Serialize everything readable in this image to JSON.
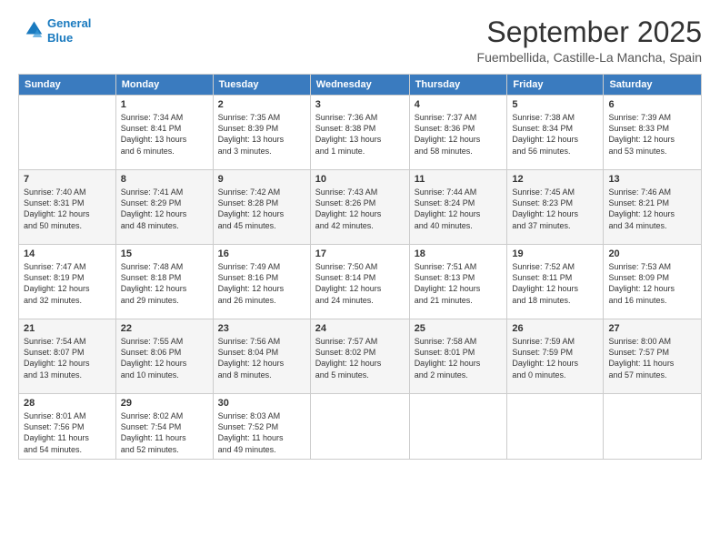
{
  "header": {
    "logo_line1": "General",
    "logo_line2": "Blue",
    "month_title": "September 2025",
    "location": "Fuembellida, Castille-La Mancha, Spain"
  },
  "days_of_week": [
    "Sunday",
    "Monday",
    "Tuesday",
    "Wednesday",
    "Thursday",
    "Friday",
    "Saturday"
  ],
  "weeks": [
    [
      {
        "day": "",
        "info": ""
      },
      {
        "day": "1",
        "info": "Sunrise: 7:34 AM\nSunset: 8:41 PM\nDaylight: 13 hours\nand 6 minutes."
      },
      {
        "day": "2",
        "info": "Sunrise: 7:35 AM\nSunset: 8:39 PM\nDaylight: 13 hours\nand 3 minutes."
      },
      {
        "day": "3",
        "info": "Sunrise: 7:36 AM\nSunset: 8:38 PM\nDaylight: 13 hours\nand 1 minute."
      },
      {
        "day": "4",
        "info": "Sunrise: 7:37 AM\nSunset: 8:36 PM\nDaylight: 12 hours\nand 58 minutes."
      },
      {
        "day": "5",
        "info": "Sunrise: 7:38 AM\nSunset: 8:34 PM\nDaylight: 12 hours\nand 56 minutes."
      },
      {
        "day": "6",
        "info": "Sunrise: 7:39 AM\nSunset: 8:33 PM\nDaylight: 12 hours\nand 53 minutes."
      }
    ],
    [
      {
        "day": "7",
        "info": "Sunrise: 7:40 AM\nSunset: 8:31 PM\nDaylight: 12 hours\nand 50 minutes."
      },
      {
        "day": "8",
        "info": "Sunrise: 7:41 AM\nSunset: 8:29 PM\nDaylight: 12 hours\nand 48 minutes."
      },
      {
        "day": "9",
        "info": "Sunrise: 7:42 AM\nSunset: 8:28 PM\nDaylight: 12 hours\nand 45 minutes."
      },
      {
        "day": "10",
        "info": "Sunrise: 7:43 AM\nSunset: 8:26 PM\nDaylight: 12 hours\nand 42 minutes."
      },
      {
        "day": "11",
        "info": "Sunrise: 7:44 AM\nSunset: 8:24 PM\nDaylight: 12 hours\nand 40 minutes."
      },
      {
        "day": "12",
        "info": "Sunrise: 7:45 AM\nSunset: 8:23 PM\nDaylight: 12 hours\nand 37 minutes."
      },
      {
        "day": "13",
        "info": "Sunrise: 7:46 AM\nSunset: 8:21 PM\nDaylight: 12 hours\nand 34 minutes."
      }
    ],
    [
      {
        "day": "14",
        "info": "Sunrise: 7:47 AM\nSunset: 8:19 PM\nDaylight: 12 hours\nand 32 minutes."
      },
      {
        "day": "15",
        "info": "Sunrise: 7:48 AM\nSunset: 8:18 PM\nDaylight: 12 hours\nand 29 minutes."
      },
      {
        "day": "16",
        "info": "Sunrise: 7:49 AM\nSunset: 8:16 PM\nDaylight: 12 hours\nand 26 minutes."
      },
      {
        "day": "17",
        "info": "Sunrise: 7:50 AM\nSunset: 8:14 PM\nDaylight: 12 hours\nand 24 minutes."
      },
      {
        "day": "18",
        "info": "Sunrise: 7:51 AM\nSunset: 8:13 PM\nDaylight: 12 hours\nand 21 minutes."
      },
      {
        "day": "19",
        "info": "Sunrise: 7:52 AM\nSunset: 8:11 PM\nDaylight: 12 hours\nand 18 minutes."
      },
      {
        "day": "20",
        "info": "Sunrise: 7:53 AM\nSunset: 8:09 PM\nDaylight: 12 hours\nand 16 minutes."
      }
    ],
    [
      {
        "day": "21",
        "info": "Sunrise: 7:54 AM\nSunset: 8:07 PM\nDaylight: 12 hours\nand 13 minutes."
      },
      {
        "day": "22",
        "info": "Sunrise: 7:55 AM\nSunset: 8:06 PM\nDaylight: 12 hours\nand 10 minutes."
      },
      {
        "day": "23",
        "info": "Sunrise: 7:56 AM\nSunset: 8:04 PM\nDaylight: 12 hours\nand 8 minutes."
      },
      {
        "day": "24",
        "info": "Sunrise: 7:57 AM\nSunset: 8:02 PM\nDaylight: 12 hours\nand 5 minutes."
      },
      {
        "day": "25",
        "info": "Sunrise: 7:58 AM\nSunset: 8:01 PM\nDaylight: 12 hours\nand 2 minutes."
      },
      {
        "day": "26",
        "info": "Sunrise: 7:59 AM\nSunset: 7:59 PM\nDaylight: 12 hours\nand 0 minutes."
      },
      {
        "day": "27",
        "info": "Sunrise: 8:00 AM\nSunset: 7:57 PM\nDaylight: 11 hours\nand 57 minutes."
      }
    ],
    [
      {
        "day": "28",
        "info": "Sunrise: 8:01 AM\nSunset: 7:56 PM\nDaylight: 11 hours\nand 54 minutes."
      },
      {
        "day": "29",
        "info": "Sunrise: 8:02 AM\nSunset: 7:54 PM\nDaylight: 11 hours\nand 52 minutes."
      },
      {
        "day": "30",
        "info": "Sunrise: 8:03 AM\nSunset: 7:52 PM\nDaylight: 11 hours\nand 49 minutes."
      },
      {
        "day": "",
        "info": ""
      },
      {
        "day": "",
        "info": ""
      },
      {
        "day": "",
        "info": ""
      },
      {
        "day": "",
        "info": ""
      }
    ]
  ]
}
